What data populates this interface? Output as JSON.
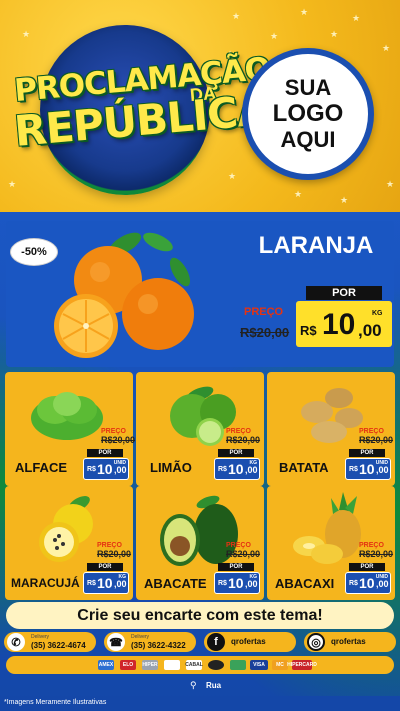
{
  "header": {
    "title_line1": "PROCLAMAÇÃO",
    "title_da": "DA",
    "title_line2": "REPÚBLICA",
    "logo_lines": [
      "SUA",
      "LOGO",
      "AQUI"
    ]
  },
  "featured": {
    "discount": "-50%",
    "name": "LARANJA",
    "old_label": "PREÇO",
    "old_price": "R$20,00",
    "por_label": "POR",
    "currency": "R$",
    "price_int": "10",
    "price_dec": ",00",
    "unit": "KG"
  },
  "products": [
    {
      "name": "ALFACE",
      "old_label": "PREÇO",
      "old_price": "R$20,00",
      "por_label": "POR",
      "currency": "R$",
      "price_int": "10",
      "price_dec": ",00",
      "unit": "UNID"
    },
    {
      "name": "LIMÃO",
      "old_label": "PREÇO",
      "old_price": "R$20,00",
      "por_label": "POR",
      "currency": "R$",
      "price_int": "10",
      "price_dec": ",00",
      "unit": "KG"
    },
    {
      "name": "BATATA",
      "old_label": "PREÇO",
      "old_price": "R$20,00",
      "por_label": "POR",
      "currency": "R$",
      "price_int": "10",
      "price_dec": ",00",
      "unit": "UNID"
    },
    {
      "name": "MARACUJÁ",
      "old_label": "PREÇO",
      "old_price": "R$20,00",
      "por_label": "POR",
      "currency": "R$",
      "price_int": "10",
      "price_dec": ",00",
      "unit": "KG"
    },
    {
      "name": "ABACATE",
      "old_label": "PREÇO",
      "old_price": "R$20,00",
      "por_label": "POR",
      "currency": "R$",
      "price_int": "10",
      "price_dec": ",00",
      "unit": "KG"
    },
    {
      "name": "ABACAXI",
      "old_label": "PREÇO",
      "old_price": "R$20,00",
      "por_label": "POR",
      "currency": "R$",
      "price_int": "10",
      "price_dec": ",00",
      "unit": "UNID"
    }
  ],
  "cta": "Crie seu encarte com este tema!",
  "contacts": {
    "whatsapp": {
      "label": "Delivery",
      "value": "(35) 3622-4674"
    },
    "phone": {
      "label": "Delivery",
      "value": "(35) 3622-4322"
    },
    "facebook": "qrofertas",
    "instagram": "qrofertas"
  },
  "payments": [
    "AMEX",
    "ELO",
    "HIPER",
    "",
    "CABAL",
    "",
    "",
    "VISA",
    "MC",
    "HIPERCARD"
  ],
  "address": "Rua",
  "footer_note": "*Imagens Meramente Ilustrativas",
  "colors": {
    "brand_blue": "#1b4fb0",
    "brand_yellow": "#f5b51d",
    "brand_green": "#0f8a3a",
    "price_yellow": "#ffe02a",
    "old_price_red": "#e53312"
  }
}
